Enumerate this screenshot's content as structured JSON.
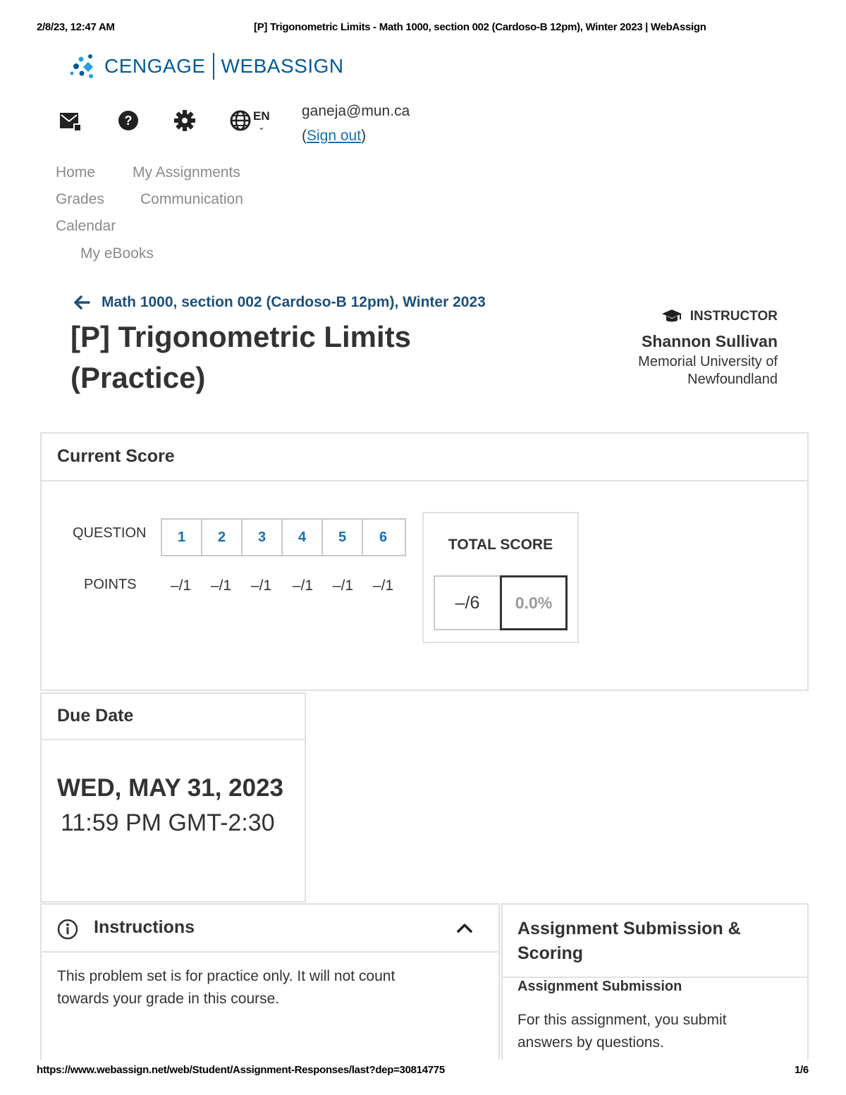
{
  "print_header": {
    "datetime": "2/8/23, 12:47 AM",
    "page_title": "[P] Trigonometric Limits - Math 1000, section 002 (Cardoso-B 12pm), Winter 2023 | WebAssign"
  },
  "brand": {
    "left": "CENGAGE",
    "right": "WEBASSIGN"
  },
  "toolbar": {
    "language": "EN",
    "user_email": "ganeja@mun.ca",
    "sign_out_open": "(",
    "sign_out": "Sign out",
    "sign_out_close": ")"
  },
  "nav": {
    "items": [
      "Home",
      "My Assignments",
      "Grades",
      "Communication",
      "Calendar",
      "My eBooks"
    ]
  },
  "assignment": {
    "course": "Math 1000, section 002 (Cardoso-B 12pm), Winter 2023",
    "title_line1": "[P] Trigonometric Limits",
    "title_line2": "(Practice)"
  },
  "instructor": {
    "label": "INSTRUCTOR",
    "name": "Shannon Sullivan",
    "org_line1": "Memorial University of",
    "org_line2": "Newfoundland"
  },
  "current_score": {
    "title": "Current Score",
    "question_label": "QUESTION",
    "points_label": "POINTS",
    "questions": [
      "1",
      "2",
      "3",
      "4",
      "5",
      "6"
    ],
    "points": [
      "–/1",
      "–/1",
      "–/1",
      "–/1",
      "–/1",
      "–/1"
    ],
    "total_label": "TOTAL SCORE",
    "total_points": "–/6",
    "total_percent": "0.0%"
  },
  "due_date": {
    "title": "Due Date",
    "date": "WED, MAY 31, 2023",
    "time": "11:59 PM GMT-2:30"
  },
  "instructions": {
    "title": "Instructions",
    "text_line1": "This problem set is for practice only. It will not count",
    "text_line2": "towards your grade in this course."
  },
  "submission": {
    "title_line1": "Assignment Submission &",
    "title_line2": "Scoring",
    "subtitle": "Assignment Submission",
    "text_line1": "For this assignment, you submit",
    "text_line2": "answers by questions."
  },
  "print_footer": {
    "url": "https://www.webassign.net/web/Student/Assignment-Responses/last?dep=30814775",
    "page": "1/6"
  },
  "colors": {
    "brand": "#005a9c",
    "link": "#1570b0",
    "nav": "#8a8a8a"
  }
}
